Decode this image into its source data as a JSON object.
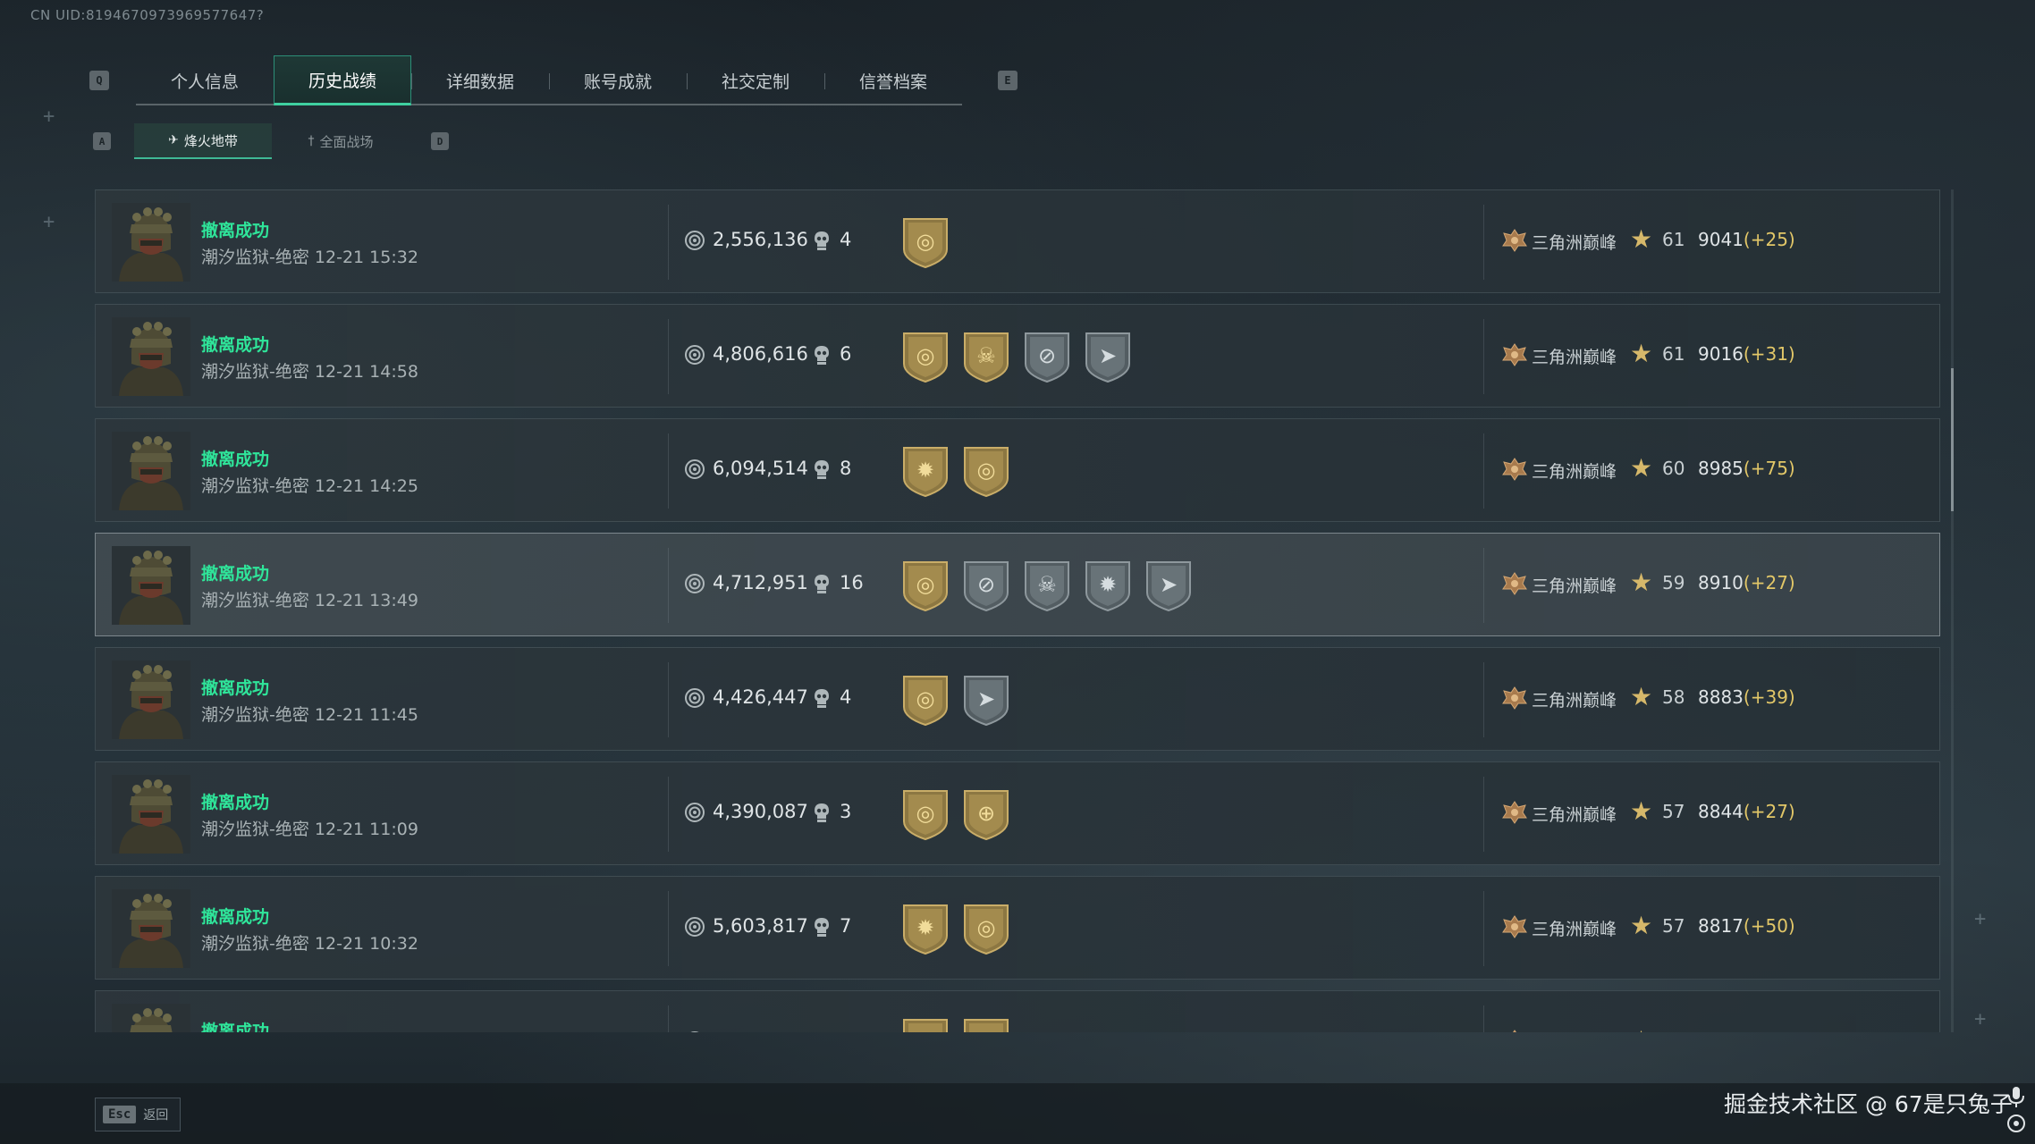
{
  "uid": "CN UID:8194670973969577647?",
  "tabs": {
    "left_key": "Q",
    "right_key": "E",
    "items": [
      {
        "label": "个人信息",
        "active": false
      },
      {
        "label": "历史战绩",
        "active": true
      },
      {
        "label": "详细数据",
        "active": false
      },
      {
        "label": "账号成就",
        "active": false
      },
      {
        "label": "社交定制",
        "active": false
      },
      {
        "label": "信誉档案",
        "active": false
      }
    ]
  },
  "subtabs": {
    "left_key": "A",
    "right_key": "D",
    "items": [
      {
        "label": "烽火地带",
        "icon": "helicopter-icon",
        "active": true
      },
      {
        "label": "全面战场",
        "icon": "soldier-icon",
        "active": false
      }
    ]
  },
  "matches": [
    {
      "status": "撤离成功",
      "map": "潮汐监狱-绝密",
      "time": "12-21 15:32",
      "value": "2,556,136",
      "kills": "4",
      "medals": [
        "gold-medal-icon"
      ],
      "rank_name": "三角洲巅峰",
      "level": "61",
      "score": "9041",
      "delta": "(+25)",
      "selected": false
    },
    {
      "status": "撤离成功",
      "map": "潮汐监狱-绝密",
      "time": "12-21 14:58",
      "value": "4,806,616",
      "kills": "6",
      "medals": [
        "gold-medal-icon",
        "gold-skull-medal-icon",
        "silver-crosshair-medal-icon",
        "silver-pistol-medal-icon"
      ],
      "rank_name": "三角洲巅峰",
      "level": "61",
      "score": "9016",
      "delta": "(+31)",
      "selected": false
    },
    {
      "status": "撤离成功",
      "map": "潮汐监狱-绝密",
      "time": "12-21 14:25",
      "value": "6,094,514",
      "kills": "8",
      "medals": [
        "gold-burst-medal-icon",
        "gold-medal-icon"
      ],
      "rank_name": "三角洲巅峰",
      "level": "60",
      "score": "8985",
      "delta": "(+75)",
      "selected": false
    },
    {
      "status": "撤离成功",
      "map": "潮汐监狱-绝密",
      "time": "12-21 13:49",
      "value": "4,712,951",
      "kills": "16",
      "medals": [
        "gold-medal-icon",
        "silver-crosshair-medal-icon",
        "silver-skull-medal-icon",
        "silver-burst-medal-icon",
        "silver-pistol-medal-icon"
      ],
      "rank_name": "三角洲巅峰",
      "level": "59",
      "score": "8910",
      "delta": "(+27)",
      "selected": true
    },
    {
      "status": "撤离成功",
      "map": "潮汐监狱-绝密",
      "time": "12-21 11:45",
      "value": "4,426,447",
      "kills": "4",
      "medals": [
        "gold-medal-icon",
        "silver-pistol-medal-icon"
      ],
      "rank_name": "三角洲巅峰",
      "level": "58",
      "score": "8883",
      "delta": "(+39)",
      "selected": false
    },
    {
      "status": "撤离成功",
      "map": "潮汐监狱-绝密",
      "time": "12-21 11:09",
      "value": "4,390,087",
      "kills": "3",
      "medals": [
        "gold-medal-icon",
        "gold-target-medal-icon"
      ],
      "rank_name": "三角洲巅峰",
      "level": "57",
      "score": "8844",
      "delta": "(+27)",
      "selected": false
    },
    {
      "status": "撤离成功",
      "map": "潮汐监狱-绝密",
      "time": "12-21 10:32",
      "value": "5,603,817",
      "kills": "7",
      "medals": [
        "gold-burst-medal-icon",
        "gold-medal-icon"
      ],
      "rank_name": "三角洲巅峰",
      "level": "57",
      "score": "8817",
      "delta": "(+50)",
      "selected": false
    },
    {
      "status": "撤离成功",
      "map": "",
      "time": "",
      "value": "",
      "kills": "",
      "medals": [
        "gold-burst-medal-icon",
        "gold-medal-icon"
      ],
      "rank_name": "",
      "level": "",
      "score": "",
      "delta": "",
      "selected": false
    }
  ],
  "footer": {
    "esc_key": "Esc",
    "esc_label": "返回",
    "watermark": "掘金技术社区 @ 67是只兔子"
  },
  "colors": {
    "success_green": "#2fe59a",
    "delta_gold": "#e2c768",
    "active_tab_accent": "#3fd0a0",
    "medal_gold": "#b89a56",
    "medal_silver": "#6f7a80"
  }
}
